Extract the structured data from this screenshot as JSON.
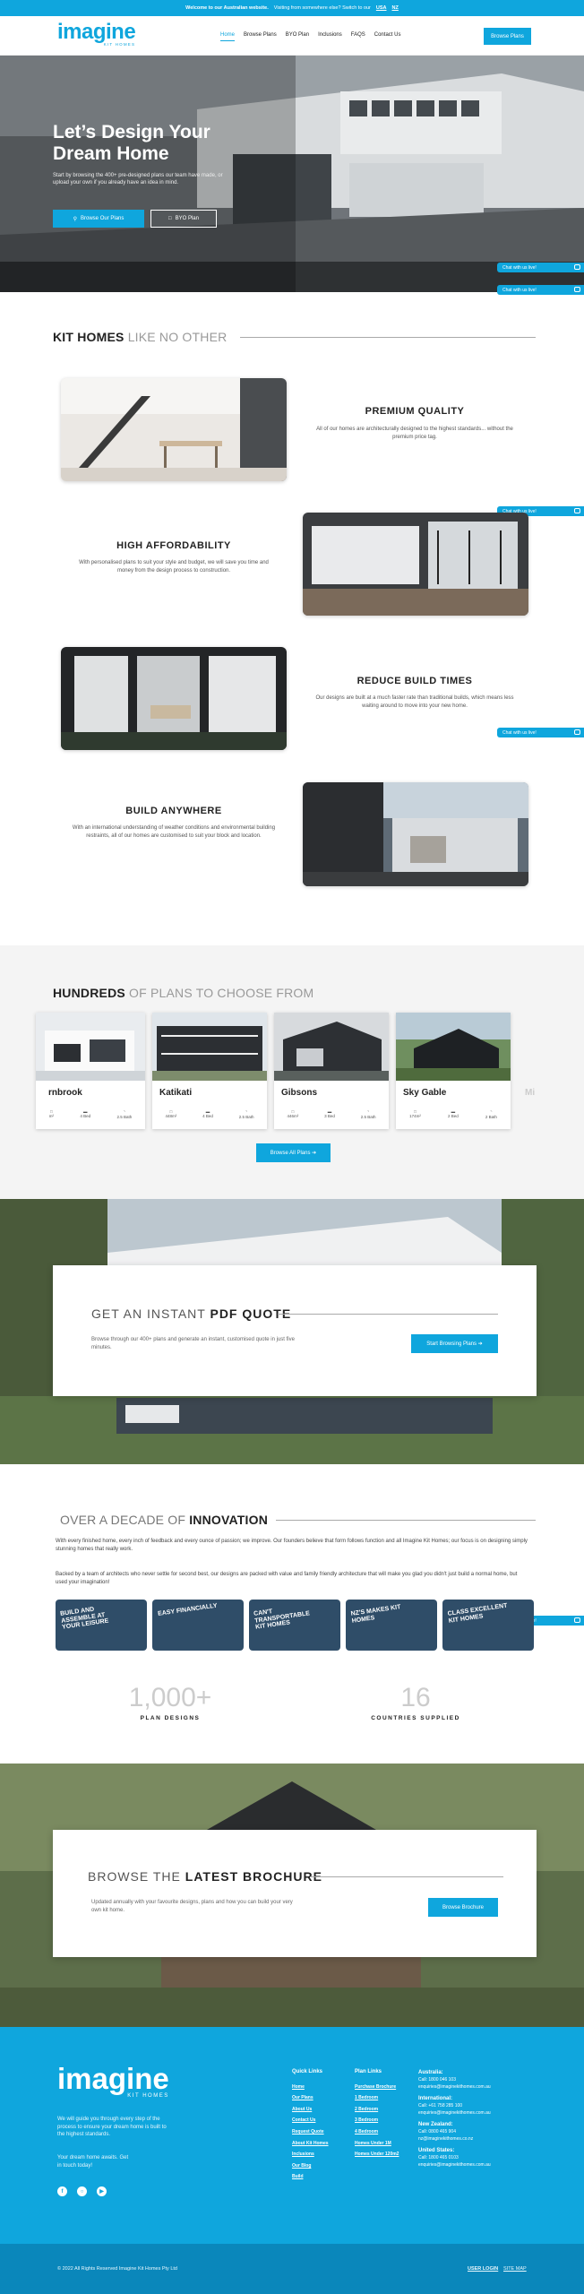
{
  "topbar": {
    "welcome": "Welcome to our Australian website.",
    "rest": "Visiting from somewhere else? Switch to our",
    "usa": "USA",
    "nz": "NZ"
  },
  "nav": {
    "logo_main": "imagine",
    "logo_sub": "KIT HOMES",
    "items": [
      "Home",
      "Browse Plans",
      "BYO Plan",
      "Inclusions",
      "FAQS",
      "Contact Us"
    ],
    "cta": "Browse Plans"
  },
  "hero": {
    "title": "Let’s Design Your Dream Home",
    "text": "Start by browsing the 400+ pre-designed plans our team have made, or upload your own if you already have an idea in mind.",
    "btn1": "Browse Our Plans",
    "btn2": "BYO Plan"
  },
  "chat_label": "Chat with us live!",
  "features": {
    "title_bold": "KIT HOMES",
    "title_light": "LIKE NO OTHER",
    "items": [
      {
        "title": "PREMIUM QUALITY",
        "text": "All of our homes are architecturally designed to the highest standards... without the premium price tag."
      },
      {
        "title": "HIGH AFFORDABILITY",
        "text": "With personalised plans to suit your style and budget, we will save you time and money from the design process to construction."
      },
      {
        "title": "REDUCE BUILD TIMES",
        "text": "Our designs are built at a much faster rate than traditional builds, which means less waiting around to move into your new home."
      },
      {
        "title": "BUILD ANYWHERE",
        "text": "With an international understanding of weather conditions and environmental building restraints, all of our homes are customised to suit your block and location."
      }
    ]
  },
  "plans": {
    "title_bold": "HUNDREDS",
    "title_light": "OF PLANS TO CHOOSE FROM",
    "cards": [
      {
        "name": "rnbrook",
        "specs": [
          "m²",
          "4 Bed",
          "2.5 Bath"
        ]
      },
      {
        "name": "Katikati",
        "specs": [
          "448m²",
          "4 Bed",
          "2.5 Bath"
        ]
      },
      {
        "name": "Gibsons",
        "specs": [
          "446m²",
          "3 Bed",
          "2.5 Bath"
        ]
      },
      {
        "name": "Sky Gable",
        "specs": [
          "174m²",
          "2 Bed",
          "2 Bath"
        ]
      }
    ],
    "peek": "Mi",
    "btn": "Browse All Plans ➔"
  },
  "quote": {
    "title_light": "GET AN INSTANT",
    "title_bold": "PDF QUOTE",
    "text": "Browse through our 400+ plans and generate an instant, customised quote in just five minutes.",
    "btn": "Start Browsing Plans ➔"
  },
  "innovation": {
    "title_light": "OVER A DECADE OF",
    "title_bold": "INNOVATION",
    "p1": "With every finished home, every inch of feedback and every ounce of passion; we improve. Our founders believe that form follows function and all Imagine Kit Homes; our focus is on designing simply stunning homes that really work.",
    "p2": "Backed by a team of architects who never settle for second best, our designs are packed with value and family friendly architecture that will make you glad you didn't just build a normal home, but used your imagination!",
    "tiles": [
      "BUILD AND ASSEMBLE AT YOUR LEISURE",
      "EASY FINANCIALLY",
      "CAN'T TRANSPORTABLE KIT HOMES",
      "NZ'S MAKES KIT HOMES",
      "CLASS EXCELLENT KIT HOMES"
    ],
    "stats": [
      {
        "num": "1,000+",
        "label": "PLAN DESIGNS"
      },
      {
        "num": "16",
        "label": "COUNTRIES SUPPLIED"
      }
    ]
  },
  "brochure": {
    "title_light": "BROWSE THE",
    "title_bold": "LATEST BROCHURE",
    "text": "Updated annually with your favourite designs, plans and how you can build your very own kit home.",
    "btn": "Browse Brochure"
  },
  "footer": {
    "logo_main": "imagine",
    "logo_sub": "KIT HOMES",
    "text1": "We will guide you through every step of the process to ensure your dream home is built to the highest standards.",
    "text2": "Your dream home awaits. Get in touch today!",
    "quick_h": "Quick Links",
    "quick": [
      "Home",
      "Our Plans",
      "About Us",
      "Contact Us",
      "Request Quote",
      "About Kit Homes",
      "Inclusions",
      "Our Blog",
      "Build"
    ],
    "plan_h": "Plan Links",
    "plan": [
      "Purchase Brochure",
      "1 Bedroom",
      "2 Bedroom",
      "3 Bedroom",
      "4 Bedroom",
      "Homes Under 1M",
      "Homes Under 120m2"
    ],
    "contacts": [
      {
        "h": "Australia:",
        "l1": "Call: 1800 046 103",
        "l2": "enquiries@imaginekithomes.com.au"
      },
      {
        "h": "International:",
        "l1": "Call: +61 758 285 100",
        "l2": "enquiries@imaginekithomes.com.au"
      },
      {
        "h": "New Zealand:",
        "l1": "Call: 0800 465 904",
        "l2": "nz@imaginekithomes.co.nz"
      },
      {
        "h": "United States:",
        "l1": "Call: 1800 465 0103",
        "l2": "enquiries@imaginekithomes.com.au"
      }
    ],
    "copyright": "© 2022 All Rights Reserved Imagine Kit Homes Pty Ltd",
    "bottom_links": [
      "USER LOGIN",
      "SITE MAP"
    ]
  },
  "colors": {
    "accent": "#0fa6dd"
  }
}
